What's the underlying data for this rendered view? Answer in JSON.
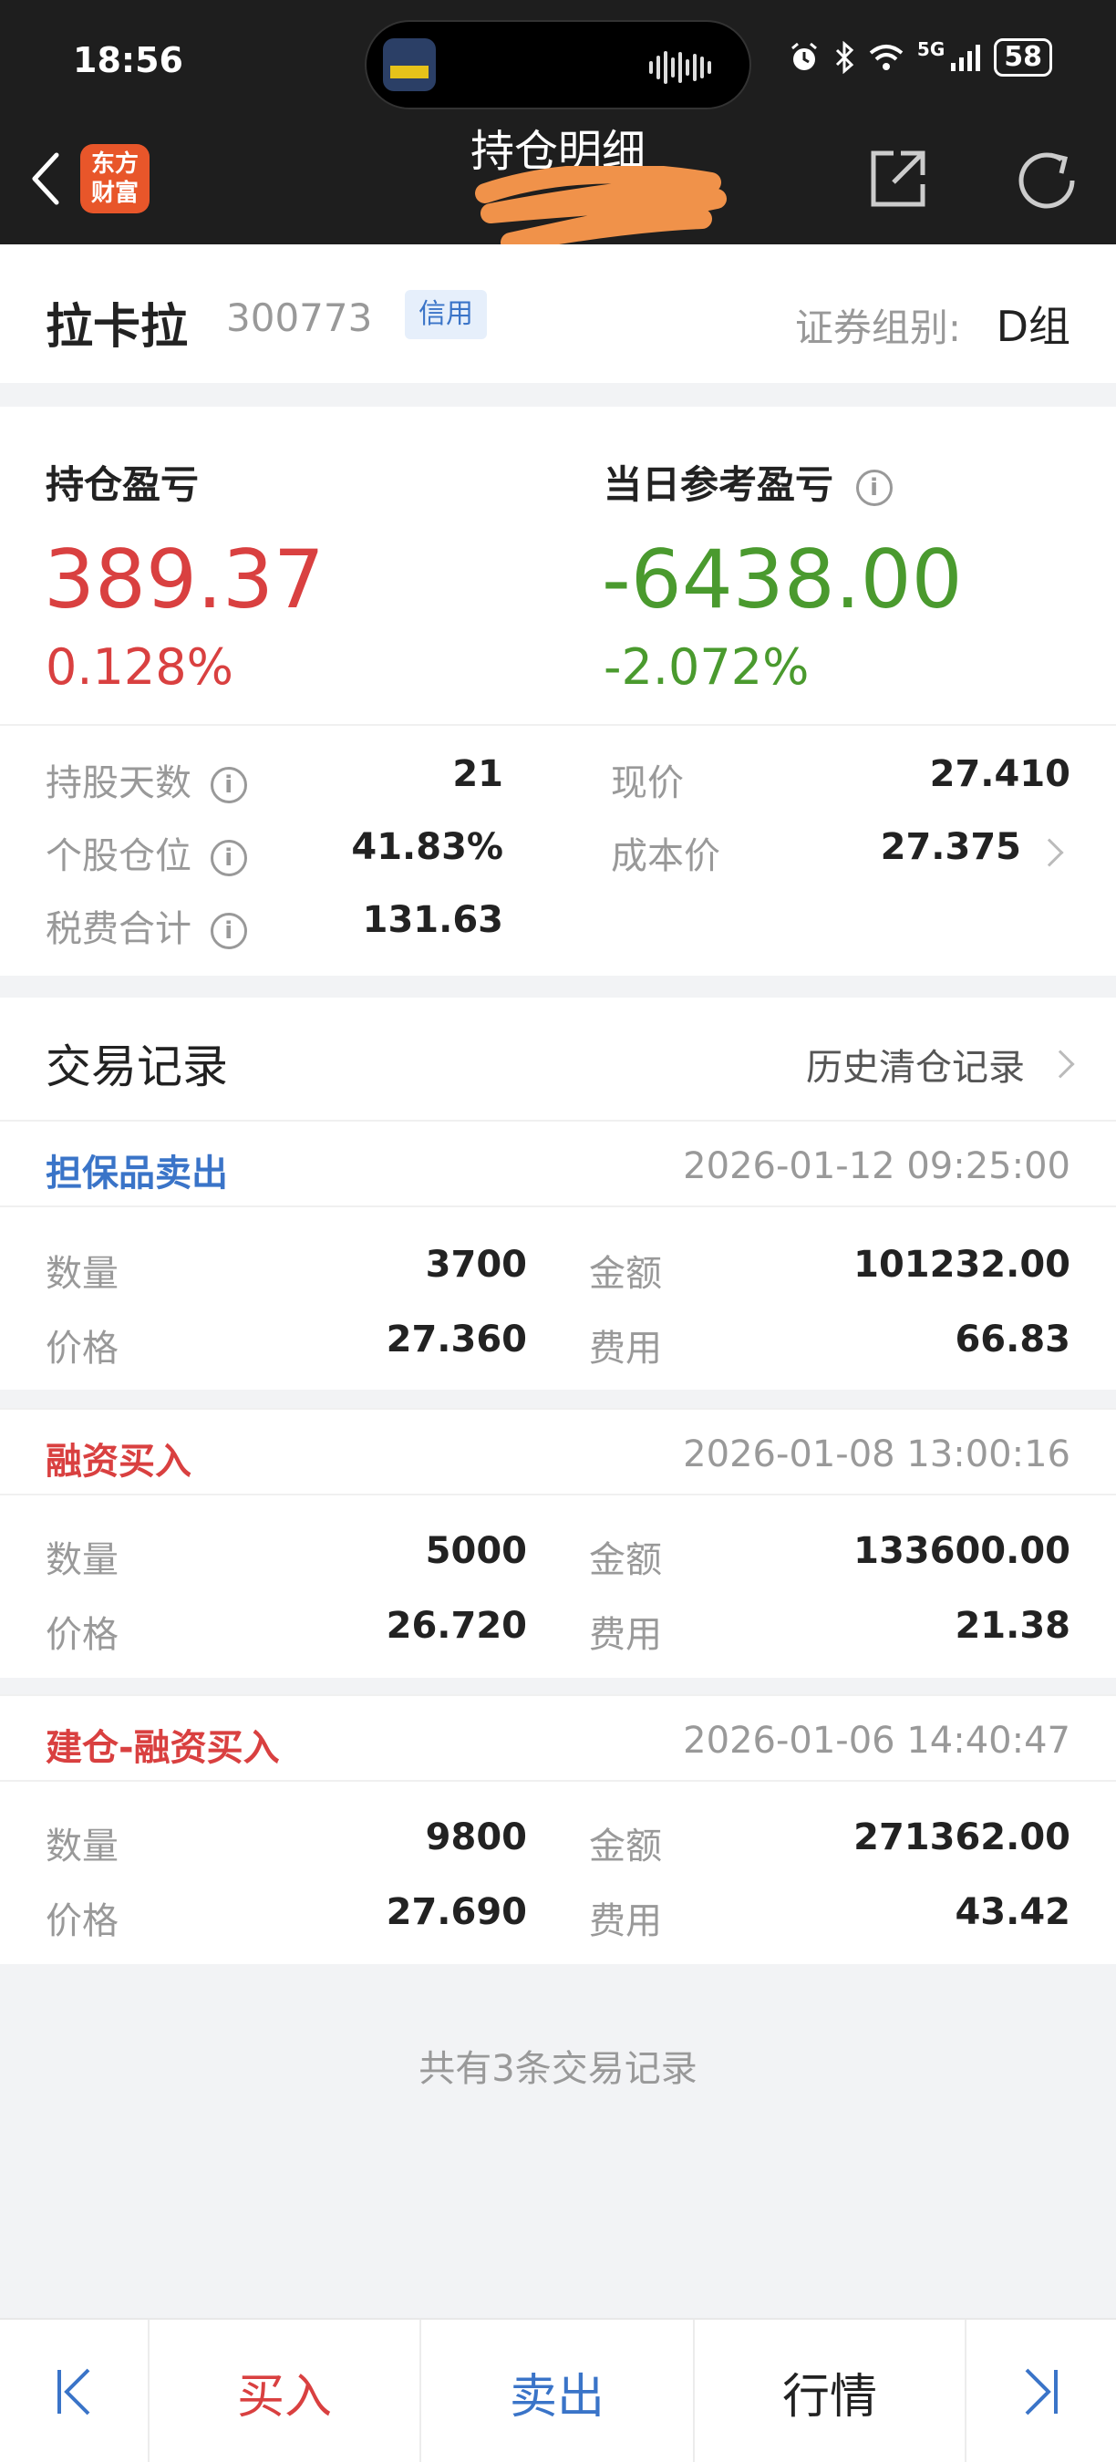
{
  "status_bar": {
    "time": "18:56",
    "network": "5G",
    "battery": "58"
  },
  "header": {
    "title": "持仓明细",
    "logo_line1": "东方",
    "logo_line2": "财富"
  },
  "stock": {
    "name": "拉卡拉",
    "code": "300773",
    "badge": "信用",
    "group_label": "证券组别:",
    "group_value": "D组"
  },
  "pnl": {
    "position_label": "持仓盈亏",
    "position_value": "389.37",
    "position_pct": "0.128%",
    "daily_label": "当日参考盈亏",
    "daily_value": "-6438.00",
    "daily_pct": "-2.072%"
  },
  "stats": {
    "days_label": "持股天数",
    "days_value": "21",
    "weight_label": "个股仓位",
    "weight_value": "41.83%",
    "fees_label": "税费合计",
    "fees_value": "131.63",
    "price_label": "现价",
    "price_value": "27.410",
    "cost_label": "成本价",
    "cost_value": "27.375"
  },
  "records": {
    "title": "交易记录",
    "history_link": "历史清仓记录",
    "qty_label": "数量",
    "amount_label": "金额",
    "price_label": "价格",
    "fee_label": "费用",
    "items": [
      {
        "type": "担保品卖出",
        "color": "#3a74c8",
        "time": "2026-01-12 09:25:00",
        "qty": "3700",
        "amount": "101232.00",
        "price": "27.360",
        "fee": "66.83"
      },
      {
        "type": "融资买入",
        "color": "#d94040",
        "time": "2026-01-08 13:00:16",
        "qty": "5000",
        "amount": "133600.00",
        "price": "26.720",
        "fee": "21.38"
      },
      {
        "type": "建仓-融资买入",
        "color": "#d94040",
        "time": "2026-01-06 14:40:47",
        "qty": "9800",
        "amount": "271362.00",
        "price": "27.690",
        "fee": "43.42"
      }
    ],
    "footer": "共有3条交易记录"
  },
  "bottom_bar": {
    "buy": "买入",
    "sell": "卖出",
    "quote": "行情"
  },
  "colors": {
    "up_red": "#d94040",
    "down_green": "#4a9a2e",
    "accent_blue": "#3a74c8",
    "brand_orange": "#e8562a"
  }
}
